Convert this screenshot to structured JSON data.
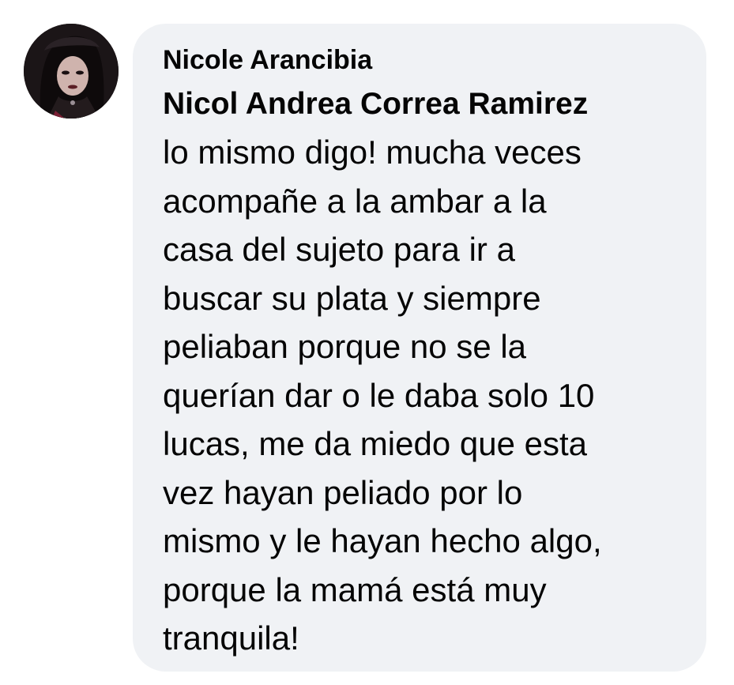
{
  "comment": {
    "author_name": "Nicole Arancibia",
    "mention_name": "Nicol Andrea Correa Ramirez",
    "text_lines": [
      "lo mismo digo! mucha veces",
      "acompañe a la ambar a la",
      "casa del sujeto para ir a",
      "buscar su plata y siempre",
      "peliaban porque no se la",
      "querían dar o le daba solo 10",
      "lucas, me da miedo que esta",
      "vez hayan peliado por lo",
      "mismo y le hayan hecho algo,",
      "porque la mamá está muy",
      "tranquila!"
    ]
  },
  "colors": {
    "bubble_background": "#f0f2f5",
    "text": "#050505",
    "secondary_text": "#65676b"
  }
}
